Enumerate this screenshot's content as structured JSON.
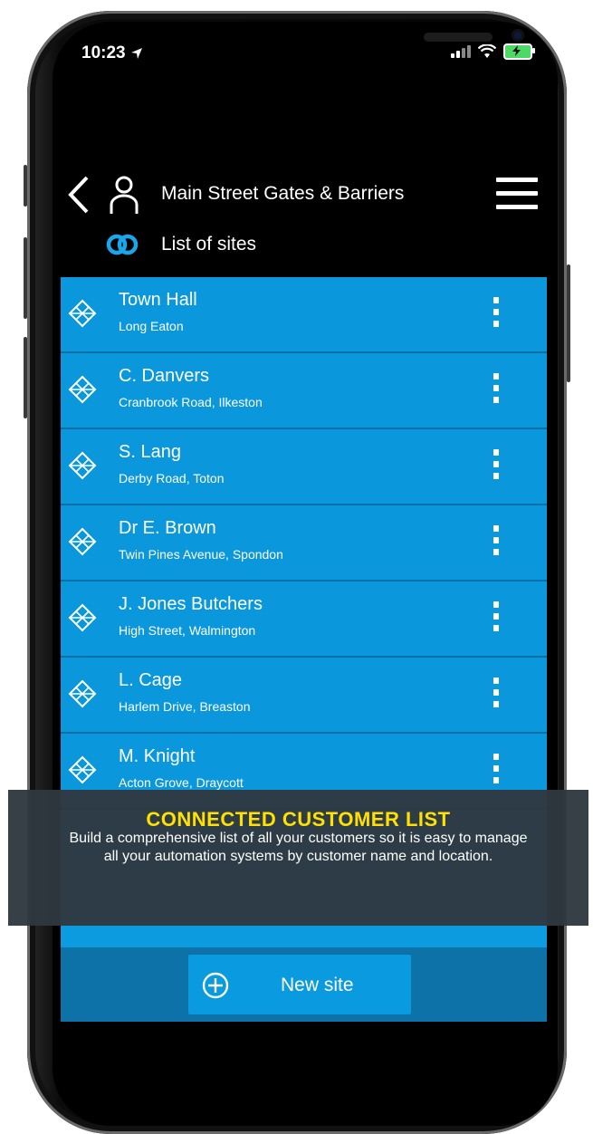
{
  "status": {
    "time": "10:23"
  },
  "header": {
    "company": "Main Street Gates & Barriers",
    "subtitle": "List of sites"
  },
  "sites": [
    {
      "name": "Town Hall",
      "location": "Long Eaton"
    },
    {
      "name": "C. Danvers",
      "location": "Cranbrook Road, Ilkeston"
    },
    {
      "name": "S. Lang",
      "location": "Derby Road, Toton"
    },
    {
      "name": "Dr E. Brown",
      "location": "Twin Pines Avenue, Spondon"
    },
    {
      "name": "J. Jones Butchers",
      "location": "High Street, Walmington"
    },
    {
      "name": "L. Cage",
      "location": "Harlem Drive, Breaston"
    },
    {
      "name": "M. Knight",
      "location": "Acton Grove, Draycott"
    }
  ],
  "footer": {
    "new_site_label": "New site"
  },
  "banner": {
    "title": "CONNECTED CUSTOMER LIST",
    "text": "Build a comprehensive list of all your customers so it is easy to manage all your automation systems by customer name and location."
  },
  "colors": {
    "list_blue": "#0a97dc",
    "bottom_bar": "#0c72a8",
    "banner_title": "#ffe000"
  }
}
